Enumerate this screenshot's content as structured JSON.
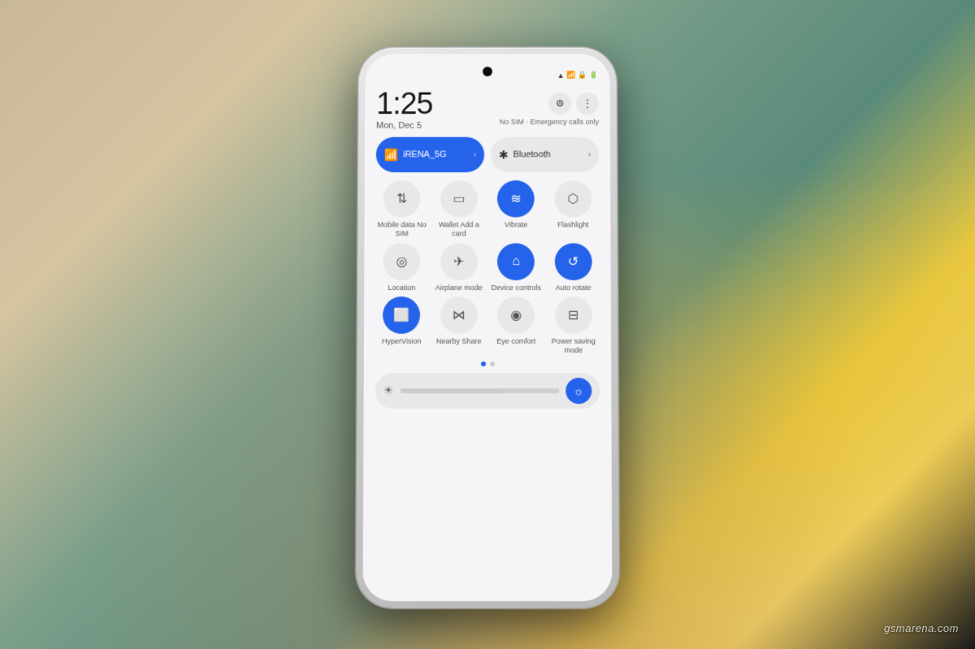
{
  "background": {
    "color1": "#c8b89a",
    "color2": "#7a9e8a",
    "color3": "#e8c840"
  },
  "statusBar": {
    "icons": [
      "wifi",
      "signal",
      "lock",
      "battery"
    ]
  },
  "time": {
    "display": "1:25",
    "date": "Mon, Dec 5"
  },
  "simStatus": "No SIM · Emergency calls only",
  "headerButtons": {
    "settings": "⚙",
    "more": "⋮"
  },
  "toggles": {
    "wifi": {
      "label": "iRENA_5G",
      "icon": "wifi",
      "active": true
    },
    "bluetooth": {
      "label": "Bluetooth",
      "icon": "bluetooth",
      "active": false
    }
  },
  "tiles": [
    {
      "id": "mobile-data",
      "label": "Mobile data\nNo SIM",
      "icon": "↑↓",
      "active": false
    },
    {
      "id": "wallet",
      "label": "Wallet\nAdd a card",
      "icon": "💳",
      "active": false
    },
    {
      "id": "vibrate",
      "label": "Vibrate",
      "icon": "📳",
      "active": true
    },
    {
      "id": "flashlight",
      "label": "Flashlight",
      "icon": "🔦",
      "active": false
    },
    {
      "id": "location",
      "label": "Location",
      "icon": "📍",
      "active": false
    },
    {
      "id": "airplane",
      "label": "Airplane\nmode",
      "icon": "✈",
      "active": false
    },
    {
      "id": "device-controls",
      "label": "Device controls",
      "icon": "⌂",
      "active": true
    },
    {
      "id": "auto-rotate",
      "label": "Auto rotate",
      "icon": "⟳",
      "active": true
    },
    {
      "id": "hypervision",
      "label": "HyperVision",
      "icon": "📷",
      "active": true
    },
    {
      "id": "nearby-share",
      "label": "Nearby Share",
      "icon": "∞",
      "active": false
    },
    {
      "id": "eye-comfort",
      "label": "Eye comfort",
      "icon": "👁",
      "active": false
    },
    {
      "id": "power-saving",
      "label": "Power saving\nmode",
      "icon": "🔋",
      "active": false
    }
  ],
  "pageDots": [
    {
      "active": true
    },
    {
      "active": false
    }
  ],
  "brightness": {
    "level": 65,
    "autoIcon": "☼"
  },
  "watermark": "gsmarena.com"
}
